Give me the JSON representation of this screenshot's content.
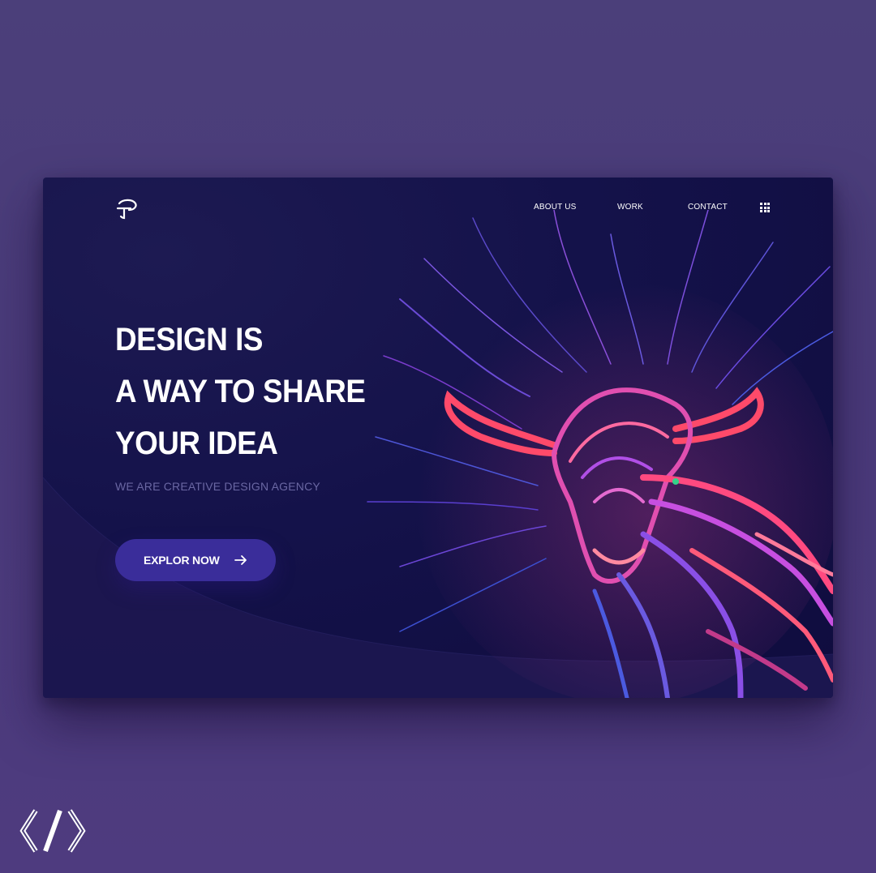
{
  "nav": {
    "items": [
      {
        "label": "ABOUT US"
      },
      {
        "label": "WORK"
      },
      {
        "label": "CONTACT"
      }
    ],
    "menu_icon": "grid-menu-icon"
  },
  "hero": {
    "headline_lines": [
      "DESIGN IS",
      "A WAY TO SHARE",
      "YOUR IDEA"
    ],
    "subtitle": "WE ARE CREATIVE DESIGN AGENCY",
    "cta_label": "EXPLOR NOW",
    "cta_icon": "arrow-right-icon"
  },
  "images": {
    "hero_art": "cable-bull-illustration",
    "logo": "agency-logo-icon",
    "watermark": "brand-mark-logo"
  },
  "colors": {
    "page_background": "#4b3f7a",
    "card_background": "#14124a",
    "cta_background": "#3a2d9a",
    "subtitle_text": "#6a67a3",
    "text": "#ffffff"
  }
}
